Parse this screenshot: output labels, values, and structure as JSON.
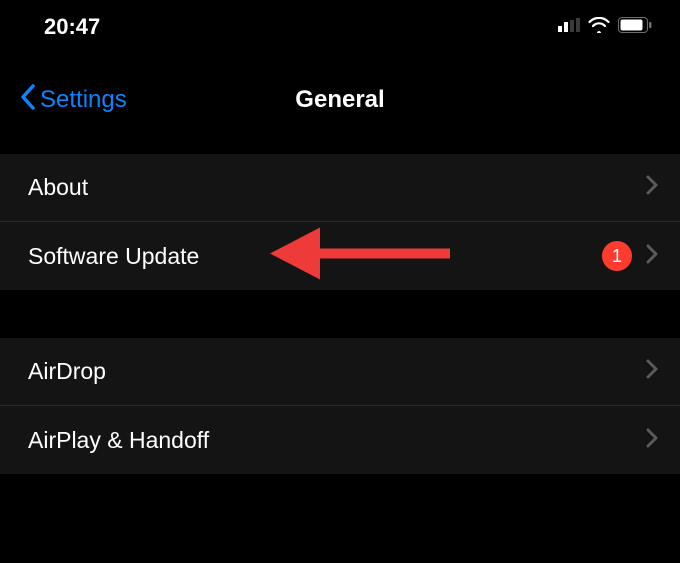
{
  "status_bar": {
    "time": "20:47"
  },
  "nav": {
    "back_label": "Settings",
    "title": "General"
  },
  "group1": {
    "items": [
      {
        "label": "About",
        "badge": null
      },
      {
        "label": "Software Update",
        "badge": "1"
      }
    ]
  },
  "group2": {
    "items": [
      {
        "label": "AirDrop",
        "badge": null
      },
      {
        "label": "AirPlay & Handoff",
        "badge": null
      }
    ]
  },
  "colors": {
    "accent": "#0a84ff",
    "badge": "#ff3b30",
    "annotation": "#ef3a3a"
  }
}
